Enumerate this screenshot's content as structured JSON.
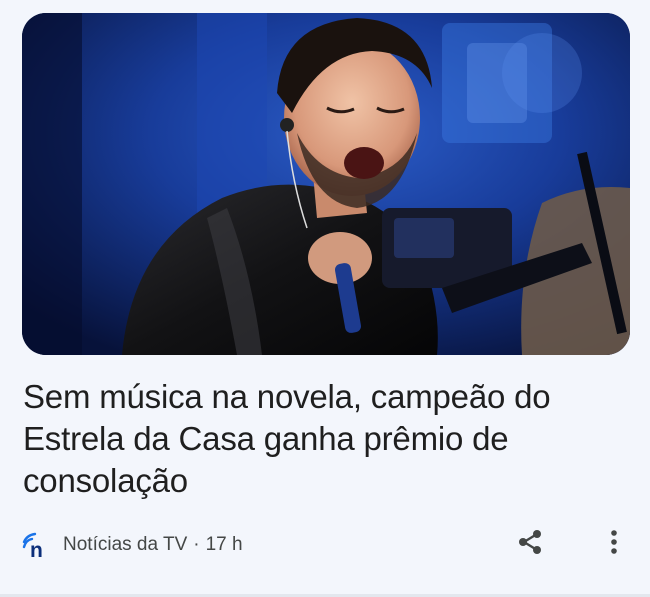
{
  "article": {
    "headline": "Sem música na novela, campeão do Estrela da Casa ganha prêmio de consolação",
    "source": "Notícias da TV",
    "separator": "·",
    "time_ago": "17 h",
    "image_subject": "singer-performing-photo"
  },
  "actions": {
    "share_icon": "share-icon",
    "more_icon": "more-vert-icon"
  },
  "colors": {
    "background": "#f3f6fc",
    "headline_text": "#1f1f1f",
    "meta_text": "#444746",
    "logo_blue": "#1a73e8"
  }
}
